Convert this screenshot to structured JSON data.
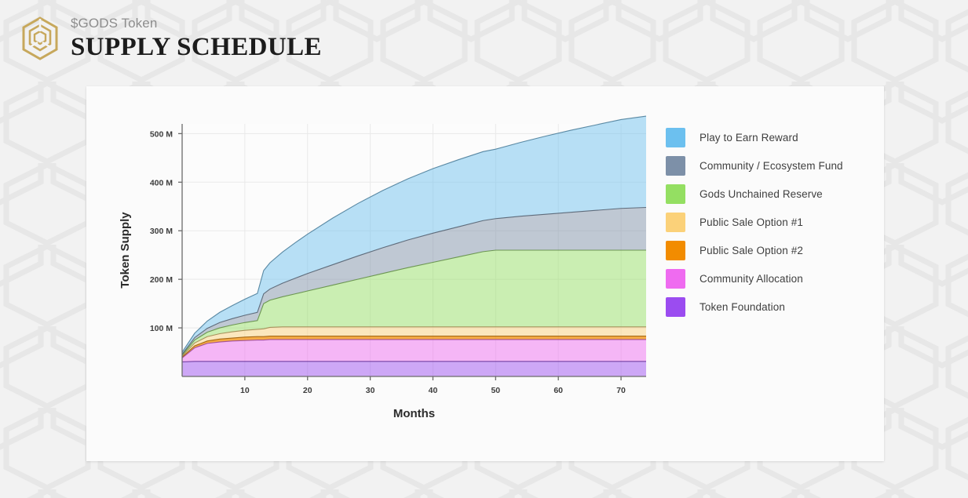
{
  "header": {
    "eyebrow": "$GODS Token",
    "title": "SUPPLY SCHEDULE",
    "logo_icon": "hexagon-token-logo-icon",
    "logo_color": "#c7a85c"
  },
  "legend": {
    "items": [
      {
        "label": "Play to Earn Reward",
        "color": "#6cc0ef"
      },
      {
        "label": "Community / Ecosystem Fund",
        "color": "#7d90a8"
      },
      {
        "label": "Gods Unchained Reserve",
        "color": "#94df62"
      },
      {
        "label": "Public Sale Option #1",
        "color": "#fbd179"
      },
      {
        "label": "Public Sale Option #2",
        "color": "#f28c00"
      },
      {
        "label": "Community Allocation",
        "color": "#ef6bf0"
      },
      {
        "label": "Token Foundation",
        "color": "#9b4cf0"
      }
    ]
  },
  "chart_data": {
    "type": "area",
    "stacked": true,
    "title": "$GODS Token Supply Schedule",
    "xlabel": "Months",
    "ylabel": "Token Supply",
    "xlim": [
      0,
      74
    ],
    "ylim": [
      0,
      520
    ],
    "xticks": [
      10,
      20,
      30,
      40,
      50,
      60,
      70
    ],
    "yticks": [
      100,
      200,
      300,
      400,
      500
    ],
    "ytick_labels": [
      "100 M",
      "200 M",
      "300 M",
      "400 M",
      "500 M"
    ],
    "value_unit": "millions of tokens",
    "grid": true,
    "legend_position": "right",
    "x": [
      0,
      2,
      4,
      6,
      8,
      10,
      12,
      13,
      14,
      16,
      18,
      20,
      24,
      28,
      32,
      36,
      40,
      44,
      48,
      50,
      54,
      58,
      62,
      66,
      70,
      74
    ],
    "series": [
      {
        "name": "Token Foundation",
        "color": "#9b4cf0",
        "values": [
          30,
          31,
          31,
          31,
          31,
          31,
          31,
          31,
          31,
          31,
          31,
          31,
          31,
          31,
          31,
          31,
          31,
          31,
          31,
          31,
          31,
          31,
          31,
          31,
          31,
          31
        ]
      },
      {
        "name": "Community Allocation",
        "color": "#ef6bf0",
        "values": [
          8,
          28,
          37,
          40,
          42,
          43,
          44,
          44,
          45,
          45,
          45,
          45,
          45,
          45,
          45,
          45,
          45,
          45,
          45,
          45,
          45,
          45,
          45,
          45,
          45,
          45
        ]
      },
      {
        "name": "Public Sale Option #2",
        "color": "#f28c00",
        "values": [
          2,
          4,
          5,
          6,
          6,
          7,
          7,
          7,
          7,
          7,
          7,
          7,
          7,
          7,
          7,
          7,
          7,
          7,
          7,
          7,
          7,
          7,
          7,
          7,
          7,
          7
        ]
      },
      {
        "name": "Public Sale Option #1",
        "color": "#fbd179",
        "values": [
          2,
          6,
          9,
          11,
          13,
          14,
          15,
          16,
          18,
          19,
          19,
          19,
          19,
          19,
          19,
          19,
          19,
          19,
          19,
          19,
          19,
          19,
          19,
          19,
          19,
          19
        ]
      },
      {
        "name": "Gods Unchained Reserve",
        "color": "#94df62",
        "values": [
          2,
          6,
          9,
          12,
          14,
          16,
          18,
          52,
          56,
          62,
          68,
          74,
          86,
          98,
          110,
          122,
          133,
          144,
          155,
          158,
          158,
          158,
          158,
          158,
          158,
          158
        ]
      },
      {
        "name": "Community / Ecosystem Fund",
        "color": "#7d90a8",
        "values": [
          2,
          5,
          8,
          11,
          13,
          15,
          17,
          20,
          23,
          28,
          32,
          36,
          42,
          48,
          53,
          57,
          60,
          62,
          64,
          65,
          70,
          74,
          78,
          82,
          86,
          88
        ]
      },
      {
        "name": "Play to Earn Reward",
        "color": "#6cc0ef",
        "values": [
          4,
          9,
          15,
          21,
          27,
          33,
          39,
          48,
          54,
          64,
          73,
          81,
          96,
          108,
          118,
          126,
          133,
          138,
          142,
          143,
          152,
          161,
          169,
          176,
          183,
          188
        ]
      }
    ]
  }
}
